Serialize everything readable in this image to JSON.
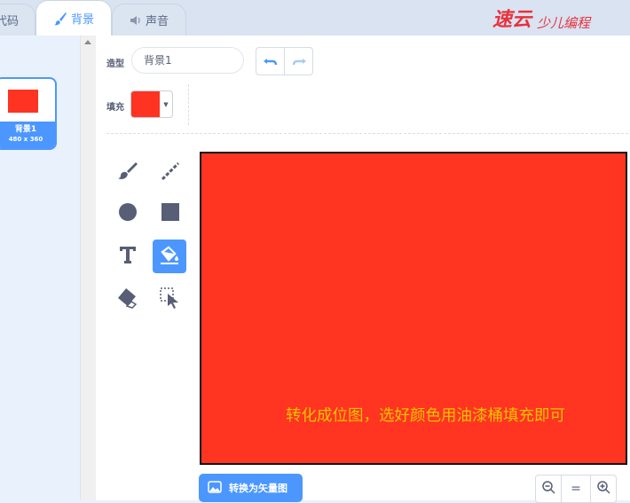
{
  "tabs": {
    "code": "代码",
    "backdrop": "背景",
    "sound": "声音"
  },
  "logo_text": "速云少儿编程",
  "costume_list": [
    {
      "name": "背景1",
      "size": "480 x 360"
    }
  ],
  "toolbar": {
    "costume_label": "造型",
    "costume_name": "背景1",
    "fill_label": "填充",
    "fill_color": "#ff3322"
  },
  "tools": [
    "brush-icon",
    "line-icon",
    "circle-icon",
    "rectangle-icon",
    "text-icon",
    "fill-icon",
    "eraser-icon",
    "select-icon"
  ],
  "active_tool": "fill-icon",
  "canvas": {
    "color": "#ff3421",
    "caption": "转化成位图，选好颜色用油漆桶填充即可"
  },
  "bottom": {
    "convert_label": "转换为矢量图",
    "zoom_reset": "="
  },
  "accent": "#4c97ff"
}
